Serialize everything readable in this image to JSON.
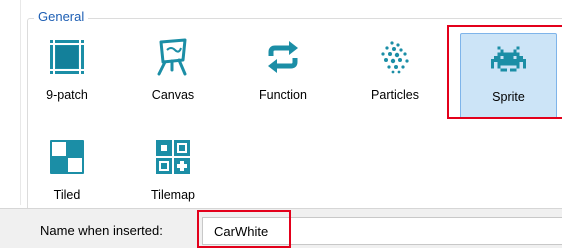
{
  "group": {
    "title": "General"
  },
  "objects": [
    {
      "label": "9-patch",
      "icon": "nine-patch-icon"
    },
    {
      "label": "Canvas",
      "icon": "canvas-easel-icon"
    },
    {
      "label": "Function",
      "icon": "function-loop-arrows-icon"
    },
    {
      "label": "Particles",
      "icon": "particles-icon"
    },
    {
      "label": "Sprite",
      "icon": "sprite-invader-icon",
      "selected": true
    },
    {
      "label": "Tiled",
      "icon": "tiled-background-icon"
    },
    {
      "label": "Tilemap",
      "icon": "tilemap-icon"
    }
  ],
  "name_field": {
    "label": "Name when inserted:",
    "value": "CarWhite"
  },
  "colors": {
    "accent": "#1e5fb4",
    "icon_teal": "#1b8ea6",
    "selection": "#cce4f7",
    "highlight": "#e3001b"
  }
}
